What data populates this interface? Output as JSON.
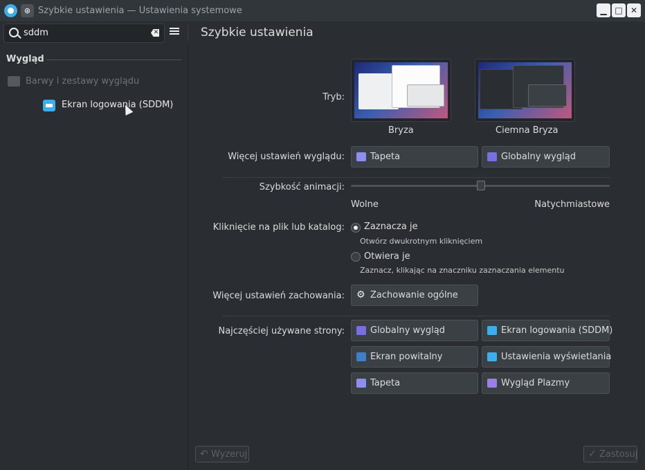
{
  "titlebar": {
    "title": "Szybkie ustawienia — Ustawienia systemowe",
    "pin_glyph": "⊛",
    "minimize_glyph": "▁",
    "maximize_glyph": "□",
    "close_glyph": "✕"
  },
  "toolbar": {
    "search_value": "sddm",
    "page_title": "Szybkie ustawienia"
  },
  "sidebar": {
    "group_title": "Wygląd",
    "items": [
      {
        "label": "Barwy i zestawy wyglądu",
        "icon": "colors-icon",
        "state": "disabled"
      },
      {
        "label": "Ekran logowania (SDDM)",
        "icon": "login-screen-icon",
        "state": "normal"
      }
    ]
  },
  "main": {
    "mode_label": "Tryb:",
    "themes": [
      {
        "name": "Bryza",
        "variant": "light"
      },
      {
        "name": "Ciemna Bryza",
        "variant": "dark"
      }
    ],
    "more_appearance_label": "Więcej ustawień wyglądu:",
    "appearance_buttons": [
      {
        "label": "Tapeta",
        "icon": "wallpaper-icon"
      },
      {
        "label": "Globalny wygląd",
        "icon": "global-theme-icon"
      }
    ],
    "animation_speed_label": "Szybkość animacji:",
    "animation_speed_min": "Wolne",
    "animation_speed_max": "Natychmiastowe",
    "animation_speed_value": 0.5,
    "click_label": "Kliknięcie na plik lub katalog:",
    "click_options": [
      {
        "label": "Zaznacza je",
        "desc": "Otwórz dwukrotnym kliknięciem",
        "selected": true
      },
      {
        "label": "Otwiera je",
        "desc": "Zaznacz, klikając na znaczniku zaznaczania elementu",
        "selected": false
      }
    ],
    "more_behavior_label": "Więcej ustawień zachowania:",
    "behavior_button": {
      "label": "Zachowanie ogólne",
      "icon": "gear-icon"
    },
    "frequent_label": "Najczęściej używane strony:",
    "frequent_pages": [
      {
        "label": "Globalny wygląd",
        "icon": "global-theme-icon"
      },
      {
        "label": "Ekran logowania (SDDM)",
        "icon": "login-screen-icon"
      },
      {
        "label": "Ekran powitalny",
        "icon": "splash-screen-icon"
      },
      {
        "label": "Ustawienia wyświetlania",
        "icon": "display-icon"
      },
      {
        "label": "Tapeta",
        "icon": "wallpaper-icon"
      },
      {
        "label": "Wygląd Plazmy",
        "icon": "plasma-style-icon"
      }
    ]
  },
  "footer": {
    "reset_label": "Wyzeruj",
    "apply_label": "Zastosuj",
    "reset_glyph": "↶",
    "apply_glyph": "✓"
  },
  "colors": {
    "accent": "#3daee9",
    "window_bg": "#2a2e32",
    "button_bg": "#3b4045"
  }
}
